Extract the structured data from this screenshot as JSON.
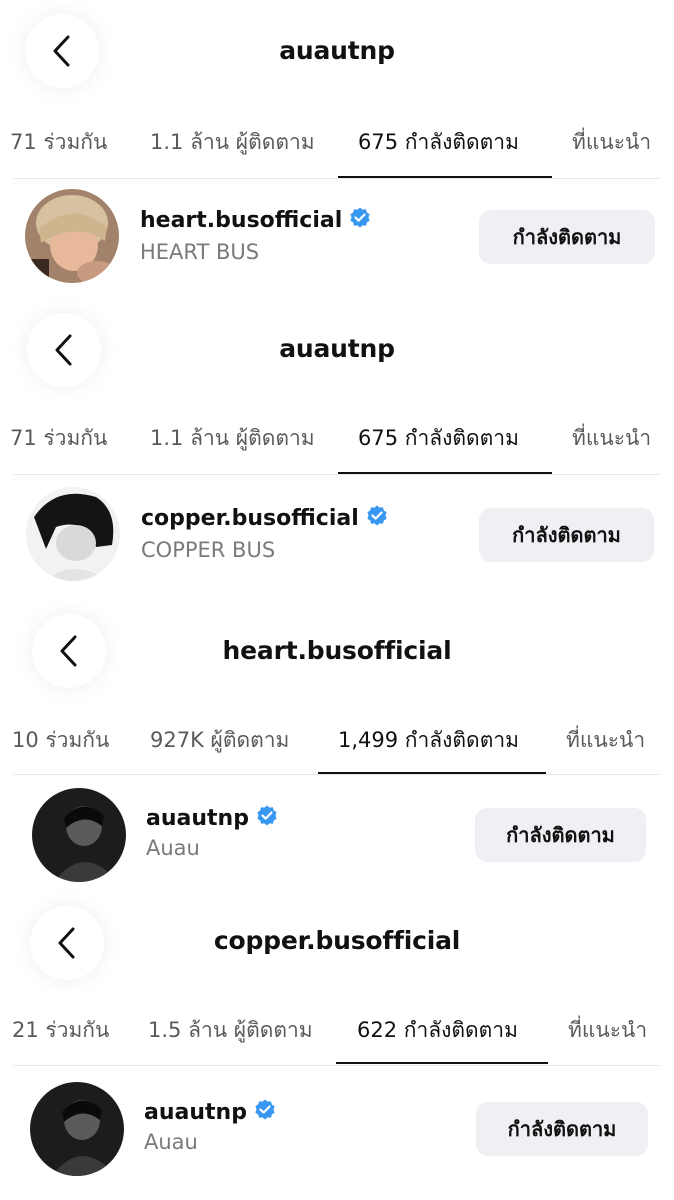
{
  "panels": [
    {
      "title": "auautnp",
      "tabs": {
        "mutual": "71 ร่วมกัน",
        "followers": "1.1 ล้าน ผู้ติดตาม",
        "following": "675 กำลังติดตาม",
        "suggested": "ที่แนะนำ"
      },
      "user": {
        "username": "heart.busofficial",
        "display_name": "HEART BUS",
        "verified": true,
        "button": "กำลังติดตาม"
      }
    },
    {
      "title": "auautnp",
      "tabs": {
        "mutual": "71 ร่วมกัน",
        "followers": "1.1 ล้าน ผู้ติดตาม",
        "following": "675 กำลังติดตาม",
        "suggested": "ที่แนะนำ"
      },
      "user": {
        "username": "copper.busofficial",
        "display_name": "COPPER BUS",
        "verified": true,
        "button": "กำลังติดตาม"
      }
    },
    {
      "title": "heart.busofficial",
      "tabs": {
        "mutual": "10 ร่วมกัน",
        "followers": "927K ผู้ติดตาม",
        "following": "1,499 กำลังติดตาม",
        "suggested": "ที่แนะนำ"
      },
      "user": {
        "username": "auautnp",
        "display_name": "Auau",
        "verified": true,
        "button": "กำลังติดตาม"
      }
    },
    {
      "title": "copper.busofficial",
      "tabs": {
        "mutual": "21 ร่วมกัน",
        "followers": "1.5 ล้าน ผู้ติดตาม",
        "following": "622 กำลังติดตาม",
        "suggested": "ที่แนะนำ"
      },
      "user": {
        "username": "auautnp",
        "display_name": "Auau",
        "verified": true,
        "button": "กำลังติดตาม"
      }
    }
  ],
  "icons": {
    "back": "chevron-left-icon",
    "verified": "verified-badge-icon"
  },
  "colors": {
    "verified": "#3897f0",
    "button_bg": "#efeff4",
    "active_tab": "#111111",
    "inactive_tab": "#5a5a5a"
  }
}
